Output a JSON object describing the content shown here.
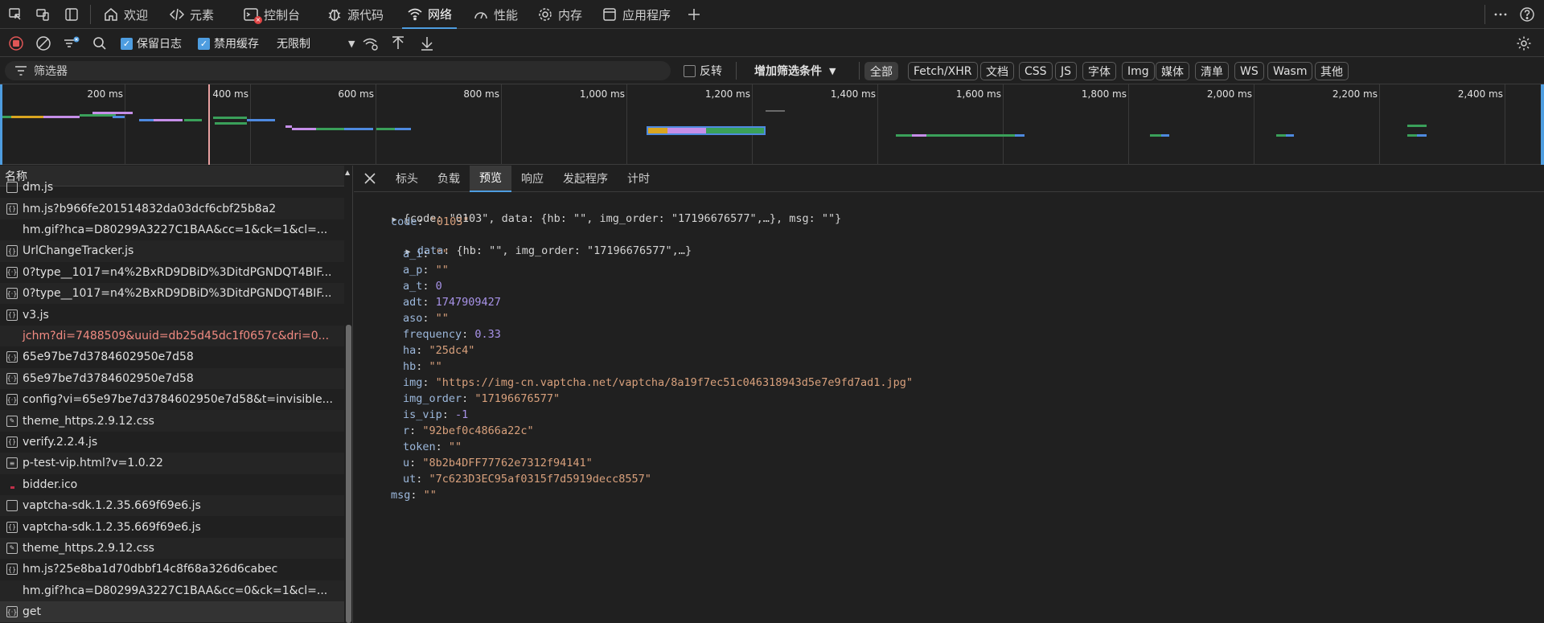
{
  "topbar": {
    "tabs": [
      {
        "label": "欢迎",
        "icon": "home-icon"
      },
      {
        "label": "元素",
        "icon": "code-icon"
      },
      {
        "label": "控制台",
        "icon": "console-icon"
      },
      {
        "label": "源代码",
        "icon": "bug-icon"
      },
      {
        "label": "网络",
        "icon": "wifi-icon"
      },
      {
        "label": "性能",
        "icon": "gauge-icon"
      },
      {
        "label": "内存",
        "icon": "gear-icon"
      },
      {
        "label": "应用程序",
        "icon": "app-icon"
      }
    ],
    "active_tab": "网络"
  },
  "toolbar": {
    "preserve_log": "保留日志",
    "disable_cache": "禁用缓存",
    "throttling": "无限制"
  },
  "filter": {
    "placeholder": "筛选器",
    "invert": "反转",
    "more_filters": "增加筛选条件",
    "types": [
      "全部",
      "Fetch/XHR",
      "文档",
      "CSS",
      "JS",
      "字体",
      "Img",
      "媒体",
      "清单",
      "WS",
      "Wasm",
      "其他"
    ]
  },
  "timeline": {
    "ticks": [
      "200 ms",
      "400 ms",
      "600 ms",
      "800 ms",
      "1,000 ms",
      "1,200 ms",
      "1,400 ms",
      "1,600 ms",
      "1,800 ms",
      "2,000 ms",
      "2,200 ms",
      "2,400 ms"
    ]
  },
  "list": {
    "header": "名称",
    "rows": [
      {
        "name": "dm.js",
        "icon": "file-icon"
      },
      {
        "name": "hm.js?b966fe201514832da03dcf6cbf25b8a2",
        "icon": "script-icon"
      },
      {
        "name": "hm.gif?hca=D80299A3227C1BAA&cc=1&ck=1&cl=...",
        "icon": "image-icon"
      },
      {
        "name": "UrlChangeTracker.js",
        "icon": "script-icon"
      },
      {
        "name": "0?type__1017=n4%2BxRD9DBiD%3DitdPGNDQT4BIF...",
        "icon": "fetch-icon"
      },
      {
        "name": "0?type__1017=n4%2BxRD9DBiD%3DitdPGNDQT4BIF...",
        "icon": "fetch-icon"
      },
      {
        "name": "v3.js",
        "icon": "script-icon"
      },
      {
        "name": "jchm?di=7488509&uuid=db25d45dc1f0657c&dri=0...",
        "icon": "error-icon",
        "error": true
      },
      {
        "name": "65e97be7d3784602950e7d58",
        "icon": "fetch-icon"
      },
      {
        "name": "65e97be7d3784602950e7d58",
        "icon": "fetch-icon"
      },
      {
        "name": "config?vi=65e97be7d3784602950e7d58&t=invisible...",
        "icon": "fetch-icon"
      },
      {
        "name": "theme_https.2.9.12.css",
        "icon": "css-icon"
      },
      {
        "name": "verify.2.2.4.js",
        "icon": "script-icon"
      },
      {
        "name": "p-test-vip.html?v=1.0.22",
        "icon": "doc-icon"
      },
      {
        "name": "bidder.ico",
        "icon": "favicon-icon"
      },
      {
        "name": "vaptcha-sdk.1.2.35.669f69e6.js",
        "icon": "file-icon"
      },
      {
        "name": "vaptcha-sdk.1.2.35.669f69e6.js",
        "icon": "script-icon"
      },
      {
        "name": "theme_https.2.9.12.css",
        "icon": "css-icon"
      },
      {
        "name": "hm.js?25e8ba1d70dbbf14c8f68a326d6cabec",
        "icon": "script-icon"
      },
      {
        "name": "hm.gif?hca=D80299A3227C1BAA&cc=0&ck=1&cl=...",
        "icon": "image-icon"
      },
      {
        "name": "get",
        "icon": "fetch-icon",
        "selected": true
      }
    ]
  },
  "detail": {
    "tabs": [
      "标头",
      "负载",
      "预览",
      "响应",
      "发起程序",
      "计时"
    ],
    "active_tab": "预览",
    "summary": "{code: \"0103\", data: {hb: \"\", img_order: \"17196676577\",…}, msg: \"\"}",
    "code_key": "code",
    "code_val": "\"0103\"",
    "data_key": "data",
    "data_summary": "{hb: \"\", img_order: \"17196676577\",…}",
    "fields": [
      {
        "key": "a_i",
        "value": "\"\"",
        "type": "string"
      },
      {
        "key": "a_p",
        "value": "\"\"",
        "type": "string"
      },
      {
        "key": "a_t",
        "value": "0",
        "type": "number"
      },
      {
        "key": "adt",
        "value": "1747909427",
        "type": "number"
      },
      {
        "key": "aso",
        "value": "\"\"",
        "type": "string"
      },
      {
        "key": "frequency",
        "value": "0.33",
        "type": "number"
      },
      {
        "key": "ha",
        "value": "\"25dc4\"",
        "type": "string"
      },
      {
        "key": "hb",
        "value": "\"\"",
        "type": "string"
      },
      {
        "key": "img",
        "value": "\"https://img-cn.vaptcha.net/vaptcha/8a19f7ec51c046318943d5e7e9fd7ad1.jpg\"",
        "type": "string"
      },
      {
        "key": "img_order",
        "value": "\"17196676577\"",
        "type": "string"
      },
      {
        "key": "is_vip",
        "value": "-1",
        "type": "number"
      },
      {
        "key": "r",
        "value": "\"92bef0c4866a22c\"",
        "type": "string"
      },
      {
        "key": "token",
        "value": "\"\"",
        "type": "string"
      },
      {
        "key": "u",
        "value": "\"8b2b4DFF77762e7312f94141\"",
        "type": "string"
      },
      {
        "key": "ut",
        "value": "\"7c623D3EC95af0315f7d5919decc8557\"",
        "type": "string"
      }
    ],
    "msg_key": "msg",
    "msg_val": "\"\""
  },
  "colors": {
    "accent": "#4e9de0",
    "string": "#d8a07c",
    "number": "#a893e8",
    "key": "#9cb8dc",
    "error": "#f28b82"
  }
}
